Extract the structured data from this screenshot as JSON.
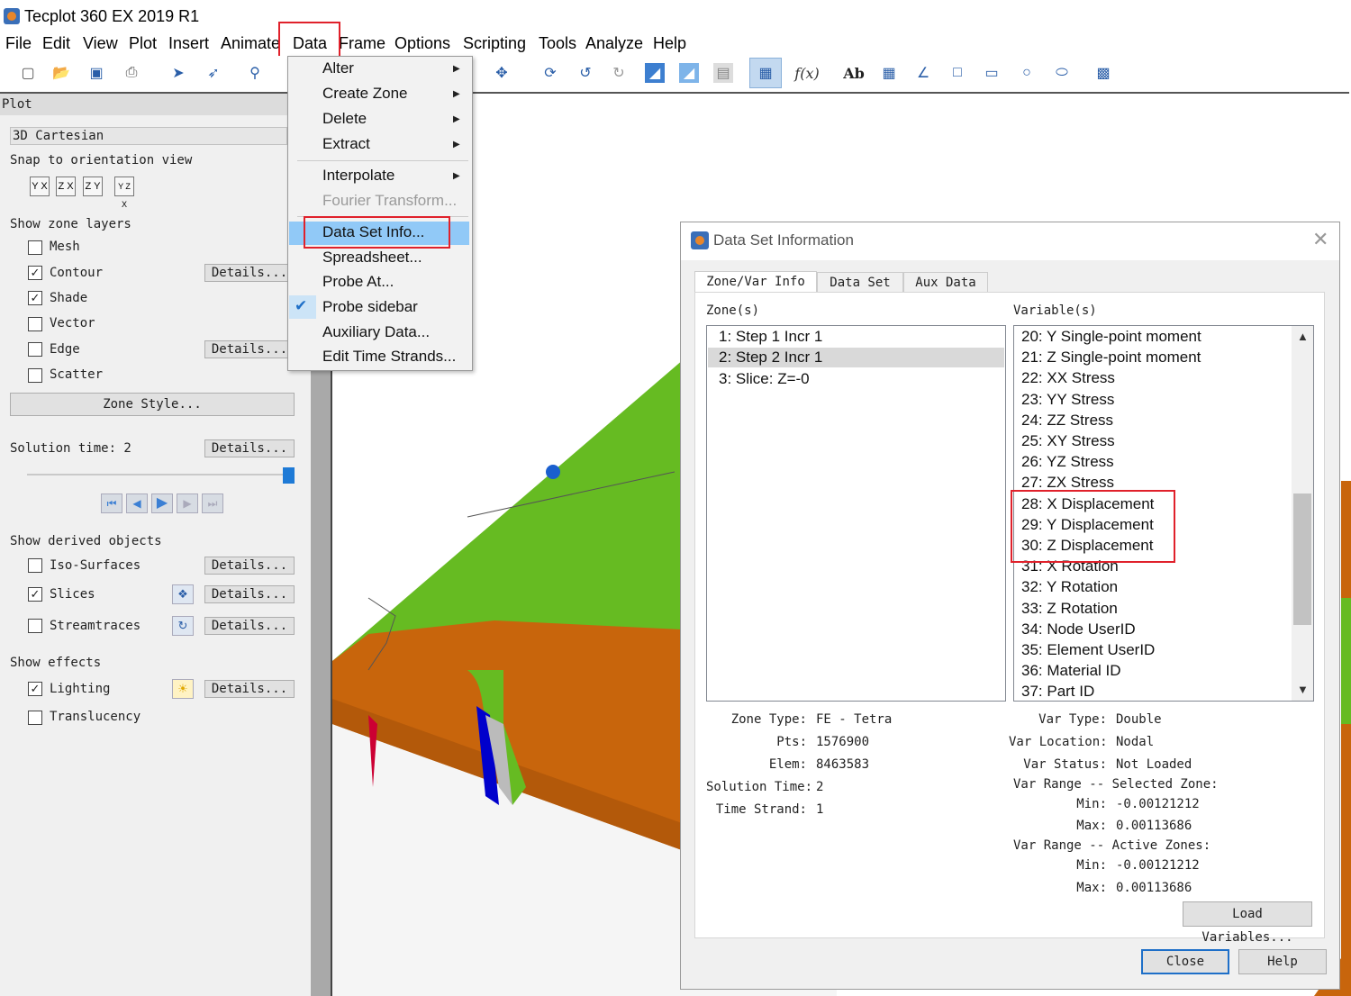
{
  "app": {
    "title": "Tecplot 360 EX 2019 R1"
  },
  "menubar": {
    "items": [
      "File",
      "Edit",
      "View",
      "Plot",
      "Insert",
      "Animate",
      "Data",
      "Frame",
      "Options",
      "Scripting",
      "Tools",
      "Analyze",
      "Help"
    ]
  },
  "data_menu": {
    "items": [
      {
        "label": "Alter",
        "submenu": true
      },
      {
        "label": "Create Zone",
        "submenu": true
      },
      {
        "label": "Delete",
        "submenu": true
      },
      {
        "label": "Extract",
        "submenu": true
      },
      {
        "label": "Interpolate",
        "submenu": true
      },
      {
        "label": "Fourier Transform...",
        "disabled": true
      },
      {
        "label": "Data Set Info...",
        "highlighted": true
      },
      {
        "label": "Spreadsheet..."
      },
      {
        "label": "Probe At..."
      },
      {
        "label": "Probe sidebar",
        "checked": true
      },
      {
        "label": "Auxiliary Data..."
      },
      {
        "label": "Edit Time Strands..."
      }
    ]
  },
  "toolbar": {
    "icons": [
      "new-icon",
      "open-icon",
      "save-icon",
      "print-icon",
      "select-icon",
      "adjust-icon",
      "zoom-icon",
      "translate-icon",
      "rotate-icon",
      "slice-icon",
      "streamtrace-icon",
      "undo-icon",
      "contour-icon",
      "fill-icon",
      "gradient-icon",
      "probe-icon",
      "formula-icon",
      "text-icon",
      "image-icon",
      "polyline-icon",
      "square-icon",
      "rectangle-icon",
      "circle-icon",
      "ellipse-icon",
      "frame-icon"
    ]
  },
  "plot_panel": {
    "header": "Plot",
    "plot_type": "3D Cartesian",
    "snap_label": "Snap to orientation view",
    "orient_buttons": [
      "Y X",
      "Z X",
      "Z Y",
      "Y Z X"
    ],
    "zone_layers_label": "Show zone layers",
    "layers": [
      {
        "label": "Mesh",
        "checked": false,
        "details": false
      },
      {
        "label": "Contour",
        "checked": true,
        "details": true
      },
      {
        "label": "Shade",
        "checked": true,
        "details": false
      },
      {
        "label": "Vector",
        "checked": false,
        "details": false
      },
      {
        "label": "Edge",
        "checked": false,
        "details": true
      },
      {
        "label": "Scatter",
        "checked": false,
        "details": false
      }
    ],
    "details_label": "Details...",
    "zone_style_label": "Zone Style...",
    "solution_time_label": "Solution time: 2",
    "derived_label": "Show derived objects",
    "derived": [
      {
        "label": "Iso-Surfaces",
        "checked": false
      },
      {
        "label": "Slices",
        "checked": true
      },
      {
        "label": "Streamtraces",
        "checked": false
      }
    ],
    "effects_label": "Show effects",
    "effects": [
      {
        "label": "Lighting",
        "checked": true
      },
      {
        "label": "Translucency",
        "checked": false
      }
    ]
  },
  "dialog": {
    "title": "Data Set Information",
    "tabs": [
      "Zone/Var Info",
      "Data Set",
      "Aux Data"
    ],
    "zones_label": "Zone(s)",
    "variables_label": "Variable(s)",
    "zones": [
      "1: Step 1 Incr 1",
      "2: Step 2 Incr 1",
      "3: Slice: Z=-0"
    ],
    "selected_zone_index": 1,
    "variables": [
      "20: Y Single-point moment",
      "21: Z Single-point moment",
      "22: XX Stress",
      "23: YY Stress",
      "24: ZZ Stress",
      "25: XY Stress",
      "26: YZ Stress",
      "27: ZX Stress",
      "28: X Displacement",
      "29: Y Displacement",
      "30: Z Displacement",
      "31: X Rotation",
      "32: Y Rotation",
      "33: Z Rotation",
      "34: Node UserID",
      "35: Element UserID",
      "36: Material ID",
      "37: Part ID"
    ],
    "zone_info": [
      {
        "k": "Zone Type:",
        "v": "FE - Tetra"
      },
      {
        "k": "Pts:",
        "v": "1576900"
      },
      {
        "k": "Elem:",
        "v": "8463583"
      },
      {
        "k": "Solution Time:",
        "v": "2"
      },
      {
        "k": "Time Strand:",
        "v": "1"
      }
    ],
    "var_info": {
      "var_type_k": "Var Type:",
      "var_type": "Double",
      "var_loc_k": "Var Location:",
      "var_loc": "Nodal",
      "var_status_k": "Var Status:",
      "var_status": "Not Loaded",
      "range_sel_label": "Var Range -- Selected Zone:",
      "min_k": "Min:",
      "max_k": "Max:",
      "sel_min": "-0.00121212",
      "sel_max": "0.00113686",
      "range_act_label": "Var Range -- Active Zones:",
      "act_min": "-0.00121212",
      "act_max": "0.00113686"
    },
    "load_variables_label": "Load Variables...",
    "close_label": "Close",
    "help_label": "Help"
  },
  "colors": {
    "highlight": "#e0212b",
    "menu_hover": "#91c9f7",
    "model_orange": "#c8650c",
    "model_green": "#66bb22"
  }
}
